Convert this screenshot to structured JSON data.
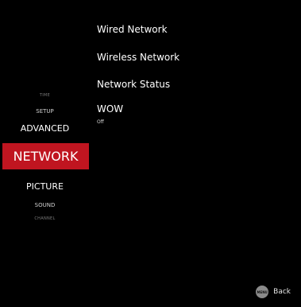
{
  "left_menu": {
    "items": [
      {
        "label": "TIME"
      },
      {
        "label": "SETUP"
      },
      {
        "label": "ADVANCED"
      },
      {
        "label": "NETWORK"
      },
      {
        "label": "PICTURE"
      },
      {
        "label": "SOUND"
      },
      {
        "label": "CHANNEL"
      }
    ],
    "selected": "NETWORK",
    "highlight_color": "#c01520"
  },
  "network_menu": {
    "items": [
      {
        "label": "Wired Network"
      },
      {
        "label": "Wireless Network"
      },
      {
        "label": "Network Status"
      },
      {
        "label": "WOW",
        "value": "Off"
      }
    ]
  },
  "footer": {
    "key_label": "MENU",
    "action_label": "Back"
  }
}
